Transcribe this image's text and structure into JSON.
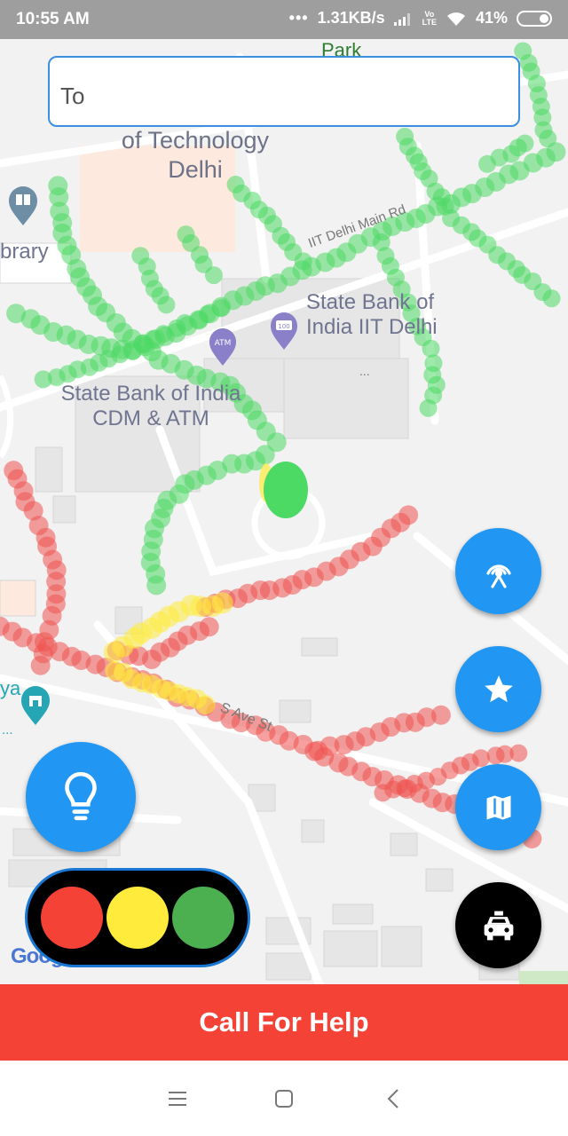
{
  "status_bar": {
    "time": "10:55 AM",
    "dots": "•••",
    "net_speed": "1.31KB/s",
    "volte_top": "Vo",
    "volte_bottom": "LTE",
    "battery": "41%"
  },
  "search": {
    "placeholder": "To"
  },
  "map": {
    "labels": {
      "park": "Park",
      "institute_line1": "of Technology",
      "institute_line2": "Delhi",
      "library": "brary",
      "road_main": "IIT Delhi Main Rd",
      "sbi_line1": "State Bank of",
      "sbi_line2": "India IIT Delhi",
      "atm_line1": "State Bank of India",
      "atm_line2": "CDM & ATM",
      "road_s_ave": "S Ave St",
      "left_poi": "ya",
      "left_poi_more": "...",
      "sbi_dots": "...",
      "google": "Google"
    }
  },
  "colors": {
    "fab_blue": "#2196f3",
    "help_red": "#f44336",
    "traffic_red": "#f44336",
    "traffic_yellow": "#ffeb3b",
    "traffic_green": "#4caf50",
    "trail_green": "#4cd964",
    "trail_red": "#ef5350",
    "trail_yellow": "#ffeb3b"
  },
  "buttons": {
    "broadcast": "broadcast-icon",
    "favorites": "star-icon",
    "map": "map-icon",
    "taxi": "taxi-icon",
    "bulb": "lightbulb-icon",
    "help_label": "Call For Help"
  },
  "nav": {
    "menu": "menu-icon",
    "home": "home-icon",
    "back": "back-icon"
  }
}
